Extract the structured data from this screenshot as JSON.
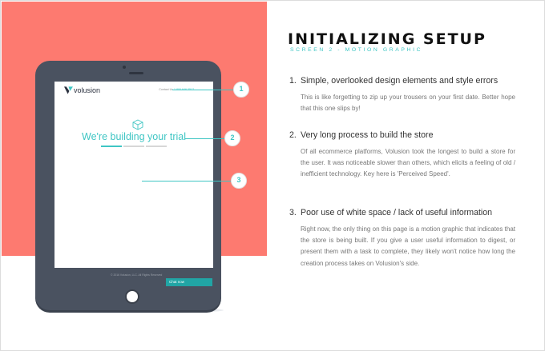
{
  "header": {
    "title": "INITIALIZING SETUP",
    "subtitle": "SCREEN 2 - MOTION GRAPHIC"
  },
  "tablet_screen": {
    "logo_text": "volusion",
    "contact_label": "Contact Us",
    "contact_phone": "1 800 646 3517",
    "building_text": "We're building your trial",
    "progress_segments": 3,
    "progress_done": 1,
    "footer_copyright": "© 2016 Volusion, LLC. All Rights Reserved",
    "chat_label": "Chat now"
  },
  "callouts": [
    "1",
    "2",
    "3"
  ],
  "items": [
    {
      "number": "1.",
      "heading": "Simple, overlooked design elements and style errors",
      "body": "This is like forgetting to zip up your trousers on your first date. Better hope that this one slips by!"
    },
    {
      "number": "2.",
      "heading": "Very long process to build the store",
      "body": "Of all ecommerce platforms, Volusion took the longest to build a store for the user. It was noticeable slower than others, which elicits a feeling of old / inefficient technology. Key here is 'Perceived Speed'."
    },
    {
      "number": "3.",
      "heading": "Poor use of white space / lack of useful information",
      "body": "Right now, the only thing on this page is a motion graphic that indicates that the store is being built. If you give a user useful information to digest, or present them with a task to complete, they likely won't notice how long the creation process takes on Volusion's side."
    }
  ],
  "colors": {
    "salmon": "#fd7a70",
    "teal": "#3fc6c4",
    "tablet": "#4a5260"
  },
  "icons": [
    "volusion-logo-icon",
    "cube-icon",
    "home-button-icon"
  ]
}
